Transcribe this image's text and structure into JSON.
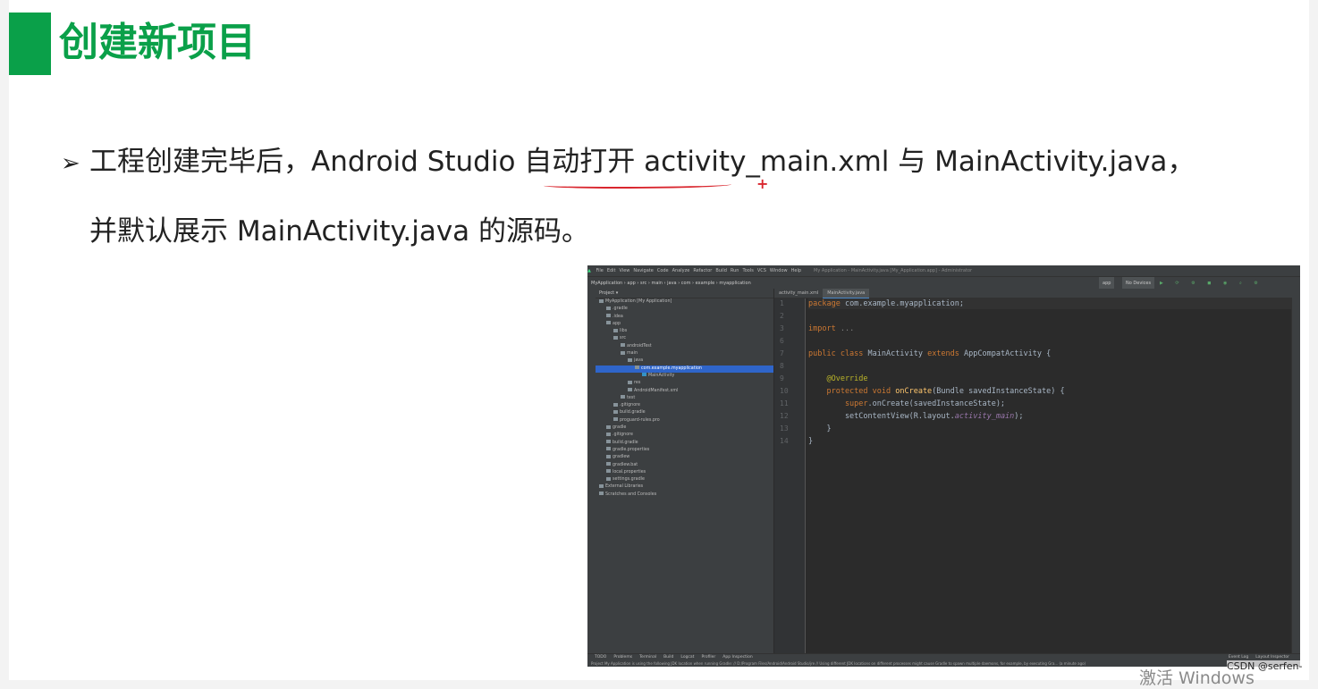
{
  "slide": {
    "title": "创建新项目",
    "bullet_arrow": "➢",
    "line1": "工程创建完毕后，Android Studio 自动打开 activity_main.xml 与 MainActivity.java，",
    "line2": "并默认展示 MainActivity.java 的源码。"
  },
  "ide": {
    "menu": [
      "File",
      "Edit",
      "View",
      "Navigate",
      "Code",
      "Analyze",
      "Refactor",
      "Build",
      "Run",
      "Tools",
      "VCS",
      "Window",
      "Help"
    ],
    "window_title": "My Application - MainActivity.java [My_Application.app] - Administrator",
    "breadcrumb": "MyApplication › app › src › main › java › com › example › myapplication",
    "run_config": "app",
    "device": "No Devices",
    "project_header": "Project ▾",
    "tree": [
      {
        "label": "MyApplication [My Application]",
        "indent": 0,
        "type": "folder"
      },
      {
        "label": ".gradle",
        "indent": 1,
        "type": "folder"
      },
      {
        "label": ".idea",
        "indent": 1,
        "type": "folder"
      },
      {
        "label": "app",
        "indent": 1,
        "type": "folder"
      },
      {
        "label": "libs",
        "indent": 2,
        "type": "folder"
      },
      {
        "label": "src",
        "indent": 2,
        "type": "folder"
      },
      {
        "label": "androidTest",
        "indent": 3,
        "type": "folder"
      },
      {
        "label": "main",
        "indent": 3,
        "type": "folder"
      },
      {
        "label": "java",
        "indent": 4,
        "type": "folder"
      },
      {
        "label": "com.example.myapplication",
        "indent": 5,
        "type": "folder",
        "selected": true
      },
      {
        "label": "MainActivity",
        "indent": 6,
        "type": "java"
      },
      {
        "label": "res",
        "indent": 4,
        "type": "folder"
      },
      {
        "label": "AndroidManifest.xml",
        "indent": 4,
        "type": "file"
      },
      {
        "label": "test",
        "indent": 3,
        "type": "folder"
      },
      {
        "label": ".gitignore",
        "indent": 2,
        "type": "file"
      },
      {
        "label": "build.gradle",
        "indent": 2,
        "type": "file"
      },
      {
        "label": "proguard-rules.pro",
        "indent": 2,
        "type": "file"
      },
      {
        "label": "gradle",
        "indent": 1,
        "type": "folder"
      },
      {
        "label": ".gitignore",
        "indent": 1,
        "type": "file"
      },
      {
        "label": "build.gradle",
        "indent": 1,
        "type": "file"
      },
      {
        "label": "gradle.properties",
        "indent": 1,
        "type": "file"
      },
      {
        "label": "gradlew",
        "indent": 1,
        "type": "file"
      },
      {
        "label": "gradlew.bat",
        "indent": 1,
        "type": "file"
      },
      {
        "label": "local.properties",
        "indent": 1,
        "type": "file"
      },
      {
        "label": "settings.gradle",
        "indent": 1,
        "type": "file"
      },
      {
        "label": "External Libraries",
        "indent": 0,
        "type": "folder"
      },
      {
        "label": "Scratches and Consoles",
        "indent": 0,
        "type": "folder"
      }
    ],
    "tabs": [
      "activity_main.xml",
      "MainActivity.java"
    ],
    "active_tab": 1,
    "line_numbers": [
      "1",
      "2",
      "3",
      "6",
      "7",
      "8",
      "9",
      "10",
      "11",
      "12",
      "13",
      "14"
    ],
    "code": {
      "l1_kw": "package",
      "l1_rest": " com.example.myapplication;",
      "l3_kw": "import",
      "l3_rest": " ...",
      "l7_a": "public class",
      "l7_b": " MainActivity ",
      "l7_c": "extends",
      "l7_d": " AppCompatActivity {",
      "l9": "    @Override",
      "l10_a": "    protected void ",
      "l10_b": "onCreate",
      "l10_c": "(Bundle savedInstanceState) {",
      "l11_a": "        super",
      "l11_b": ".onCreate(savedInstanceState);",
      "l12_a": "        setContentView(R.layout.",
      "l12_b": "activity_main",
      "l12_c": ");",
      "l13": "    }",
      "l14": "}"
    },
    "bottom_tools": [
      "TODO",
      "Problems",
      "Terminal",
      "Build",
      "Logcat",
      "Profiler",
      "App Inspection"
    ],
    "bottom_right_tools": [
      "Event Log",
      "Layout Inspector"
    ],
    "status": "Project My Application is using the following JDK location when running Gradle: // D:/Program Files/Android/Android Studio/jre // Using different JDK locations on different processes might cause Gradle to spawn multiple daemons, for example, by executing Gra... (a minute ago)"
  },
  "watermark": {
    "csdn": "CSDN @serfen-",
    "windows": "激活 Windows"
  }
}
